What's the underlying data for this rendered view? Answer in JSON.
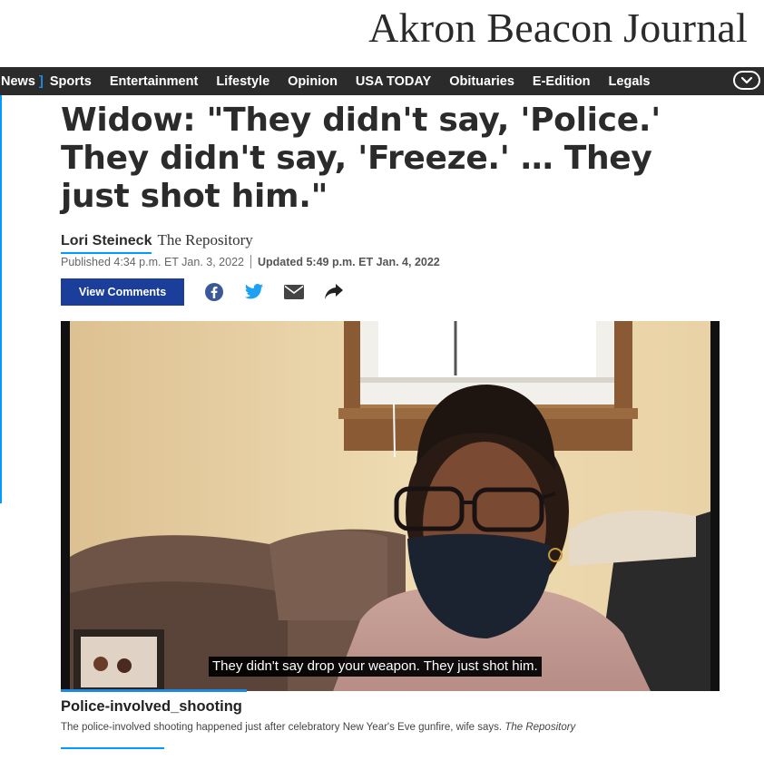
{
  "masthead": {
    "logo_text": "Akron Beacon Journal"
  },
  "nav": {
    "items": [
      "News",
      "Sports",
      "Entertainment",
      "Lifestyle",
      "Opinion",
      "USA TODAY",
      "Obituaries",
      "E-Edition",
      "Legals"
    ],
    "active_marker": "]",
    "more_icon": "chevron-down-icon"
  },
  "article": {
    "headline": "Widow: \"They didn't say, 'Police.' They didn't say, 'Freeze.' … They just shot him.\"",
    "author": "Lori Steineck",
    "source": "The Repository",
    "published": "Published 4:34 p.m. ET Jan. 3, 2022",
    "updated": "Updated 5:49 p.m. ET Jan. 4, 2022",
    "view_comments_label": "View Comments",
    "share_icons": [
      "facebook-icon",
      "twitter-icon",
      "email-icon",
      "share-icon"
    ]
  },
  "video": {
    "subtitle": "They didn't say drop your weapon. They just shot him.",
    "title": "Police-involved_shooting",
    "description": "The police-involved shooting happened just after celebratory New Year's Eve gunfire, wife says.",
    "credit": "The Repository"
  },
  "colors": {
    "accent": "#009bff",
    "nav_bg": "#2b2b2b",
    "button_bg": "#1a3e9a",
    "facebook": "#3b5998",
    "twitter": "#1da1f2"
  }
}
